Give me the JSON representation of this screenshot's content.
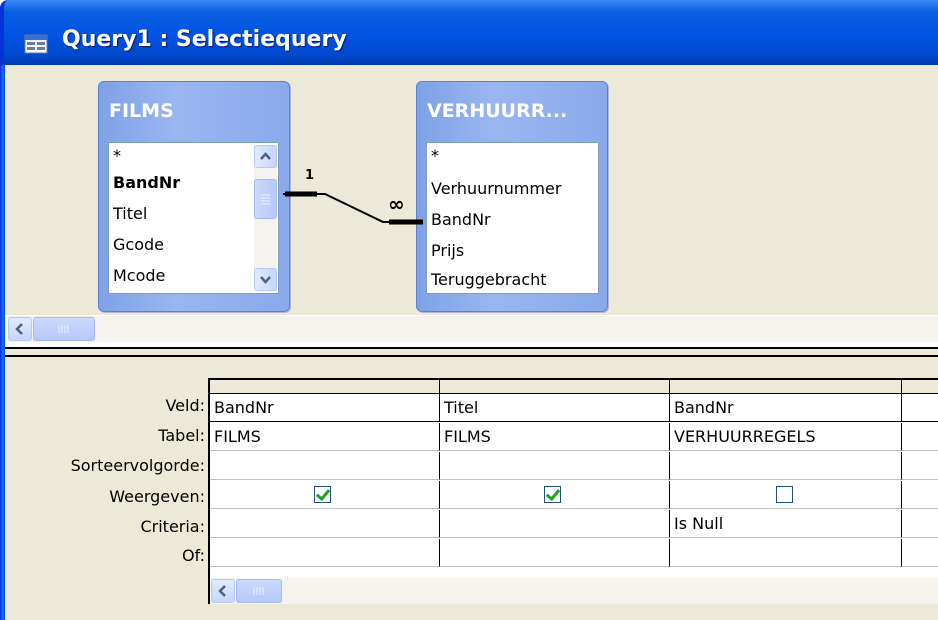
{
  "window": {
    "title": "Query1 : Selectiequery",
    "icon": "query-icon"
  },
  "tables": [
    {
      "name": "FILMS",
      "fields": [
        "*",
        "BandNr",
        "Titel",
        "Gcode",
        "Mcode"
      ],
      "key_field": "BandNr"
    },
    {
      "name": "VERHUURR...",
      "fields": [
        "*",
        "Verhuurnummer",
        "BandNr",
        "Prijs",
        "Teruggebracht"
      ]
    }
  ],
  "relationship": {
    "from_label": "1",
    "to_label": "∞"
  },
  "grid": {
    "row_labels": {
      "field": "Veld:",
      "table": "Tabel:",
      "sort": "Sorteervolgorde:",
      "show": "Weergeven:",
      "criteria": "Criteria:",
      "or": "Of:"
    },
    "columns": [
      {
        "field": "BandNr",
        "table": "FILMS",
        "sort": "",
        "show": true,
        "criteria": "",
        "or": ""
      },
      {
        "field": "Titel",
        "table": "FILMS",
        "sort": "",
        "show": true,
        "criteria": "",
        "or": ""
      },
      {
        "field": "BandNr",
        "table": "VERHUURREGELS",
        "sort": "",
        "show": false,
        "criteria": "Is Null",
        "or": ""
      },
      {
        "field": "",
        "table": "",
        "sort": "",
        "show": null,
        "criteria": "",
        "or": ""
      }
    ]
  },
  "colors": {
    "titlebar": "#0054e3",
    "pane": "#ece9d8",
    "table_header": "#8aaaea",
    "checkmark": "#21a121"
  }
}
